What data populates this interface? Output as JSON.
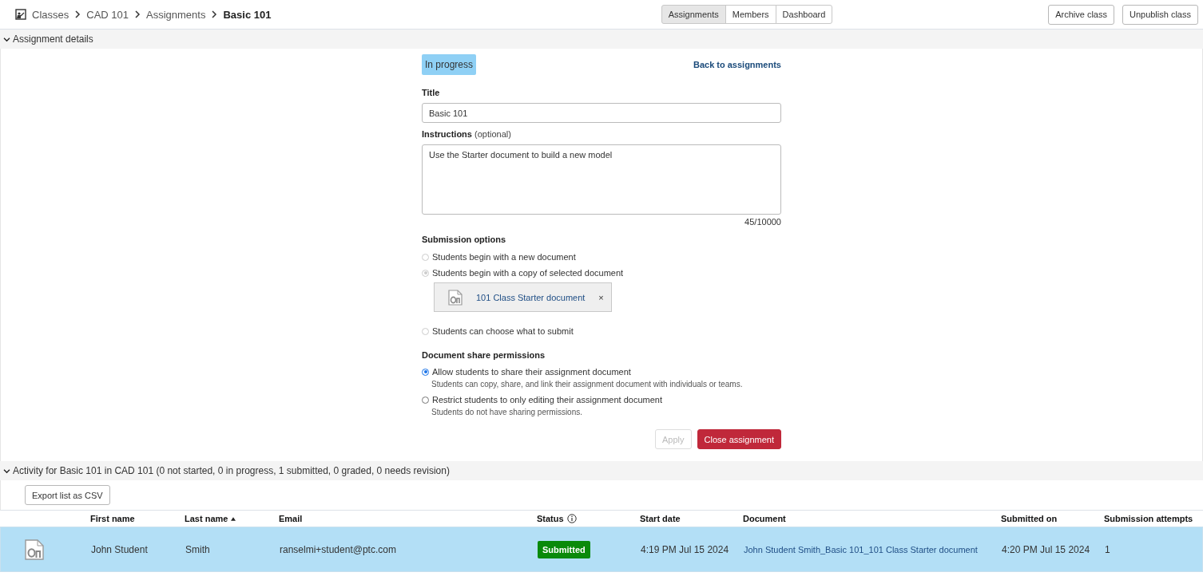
{
  "breadcrumbs": [
    {
      "label": "Classes",
      "current": false
    },
    {
      "label": "CAD 101",
      "current": false
    },
    {
      "label": "Assignments",
      "current": false
    },
    {
      "label": "Basic 101",
      "current": true
    }
  ],
  "tabs": [
    {
      "label": "Assignments",
      "selected": true
    },
    {
      "label": "Members",
      "selected": false
    },
    {
      "label": "Dashboard",
      "selected": false
    }
  ],
  "header_buttons": [
    "Archive class",
    "Unpublish class"
  ],
  "details": {
    "heading": "Assignment details",
    "expanded": true,
    "status_badge": "In progress",
    "back_link": "Back to assignments",
    "title_label": "Title",
    "title_value": "Basic 101",
    "instructions_label": "Instructions",
    "instructions_hint": "(optional)",
    "instructions_value": "Use the Starter document to build a new model",
    "char_count": "45/10000",
    "submission_heading": "Submission options",
    "submission_options": [
      {
        "label": "Students begin with a new document",
        "selected": false,
        "disabled": true
      },
      {
        "label": "Students begin with a copy of selected document",
        "selected": true,
        "disabled": true,
        "document": "101 Class Starter document",
        "remove": "×"
      },
      {
        "label": "Students can choose what to submit",
        "selected": false,
        "disabled": true
      }
    ],
    "share_heading": "Document share permissions",
    "share_options": [
      {
        "label": "Allow students to share their assignment document",
        "description": "Students can copy, share, and link their assignment document with individuals or teams.",
        "selected": true,
        "disabled": false
      },
      {
        "label": "Restrict students to only editing their assignment document",
        "description": "Students do not have sharing permissions.",
        "selected": false,
        "disabled": false
      }
    ],
    "apply_button": {
      "label": "Apply",
      "disabled": true
    },
    "close_button": "Close assignment"
  },
  "activity": {
    "heading": "Activity for Basic 101 in CAD 101 (0 not started, 0 in progress, 1 submitted, 0 graded, 0 needs revision)",
    "expanded": true,
    "export_button": "Export list as CSV",
    "columns": [
      {
        "label": "First name",
        "sorted": false
      },
      {
        "label": "Last name",
        "sorted": true
      },
      {
        "label": "Email",
        "sorted": false
      },
      {
        "label": "Status",
        "sorted": false,
        "info": true
      },
      {
        "label": "Start date",
        "sorted": false
      },
      {
        "label": "Document",
        "sorted": false
      },
      {
        "label": "Submitted on",
        "sorted": false
      },
      {
        "label": "Submission attempts",
        "sorted": false
      }
    ],
    "rows": [
      {
        "selected": true,
        "first_name": "John Student",
        "last_name": "Smith",
        "email": "ranselmi+student@ptc.com",
        "status": "Submitted",
        "color": "#0a8a0a",
        "start_date": "4:19 PM Jul 15 2024",
        "document": "John Student Smith_Basic 101_101 Class Starter document",
        "submitted_on": "4:20 PM Jul 15 2024",
        "attempts": "1"
      }
    ]
  }
}
